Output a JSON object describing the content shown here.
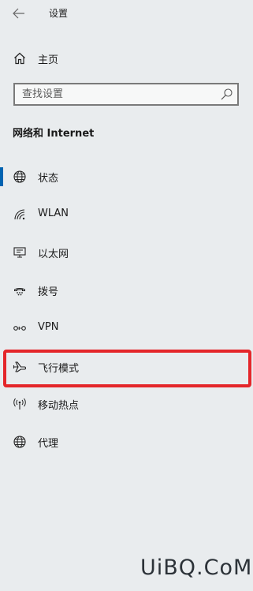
{
  "window": {
    "title": "设置"
  },
  "home": {
    "label": "主页"
  },
  "search": {
    "placeholder": "查找设置"
  },
  "section": {
    "title": "网络和 Internet"
  },
  "nav": {
    "items": [
      {
        "label": "状态",
        "icon": "globe-icon",
        "selected": true
      },
      {
        "label": "WLAN",
        "icon": "wifi-icon"
      },
      {
        "label": "以太网",
        "icon": "ethernet-icon"
      },
      {
        "label": "拨号",
        "icon": "dialup-icon"
      },
      {
        "label": "VPN",
        "icon": "vpn-icon"
      },
      {
        "label": "飞行模式",
        "icon": "airplane-icon",
        "highlighted": true
      },
      {
        "label": "移动热点",
        "icon": "hotspot-icon"
      },
      {
        "label": "代理",
        "icon": "globe-icon"
      }
    ]
  },
  "colors": {
    "accent": "#0063b1",
    "highlight": "#e4262a",
    "background": "#e9ecee"
  },
  "watermark": {
    "text": "UiBQ.CoM"
  }
}
